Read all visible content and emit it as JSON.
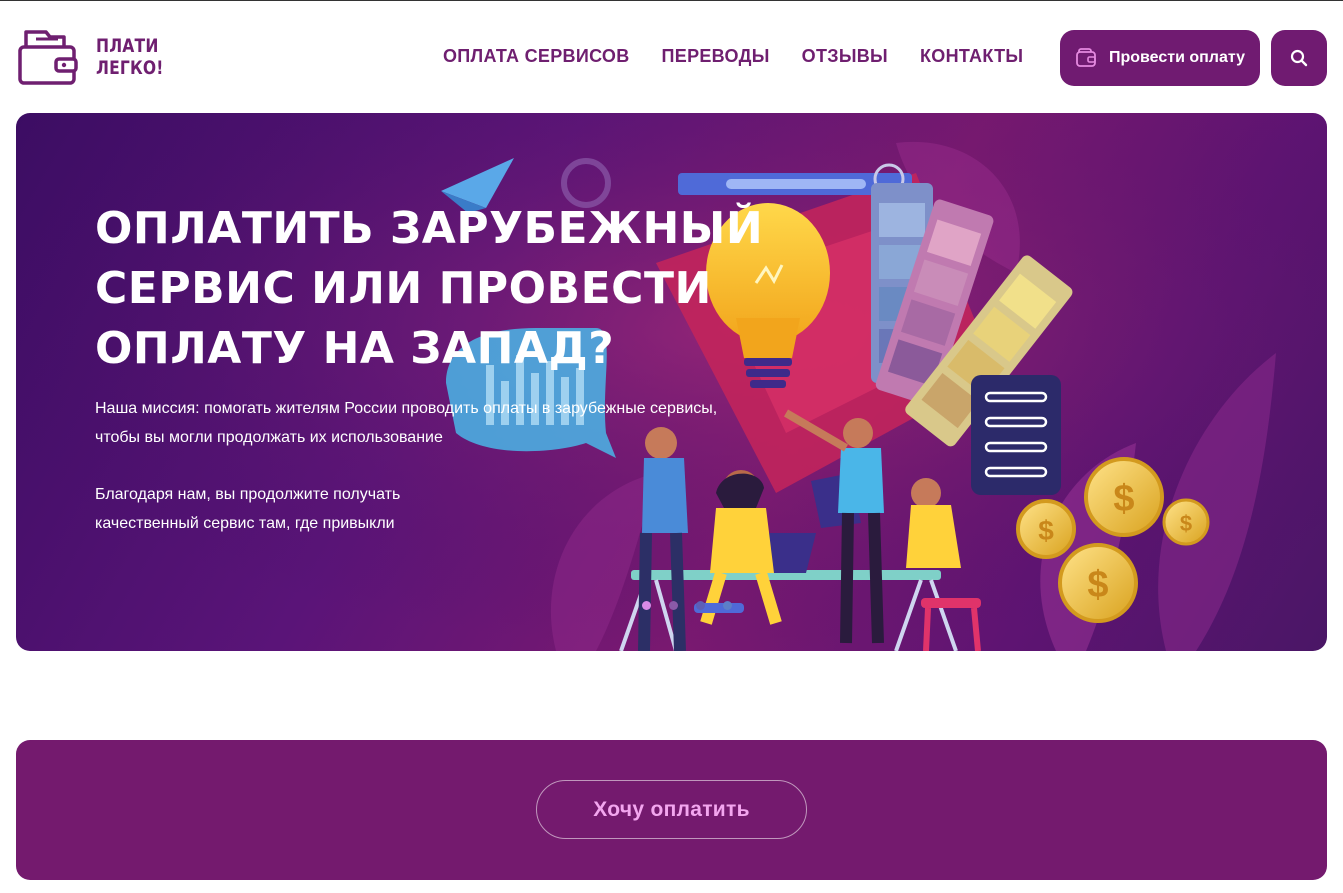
{
  "brand": {
    "logo_line1": "ПЛАТИ",
    "logo_line2": "ЛЕГКО!",
    "logo_icon": "wallet-icon",
    "color": "#6f1f70"
  },
  "nav": {
    "items": [
      {
        "label": "ОПЛАТА СЕРВИСОВ"
      },
      {
        "label": "ПЕРЕВОДЫ"
      },
      {
        "label": "ОТЗЫВЫ"
      },
      {
        "label": "КОНТАКТЫ"
      }
    ]
  },
  "header_actions": {
    "pay_label": "Провести оплату",
    "pay_icon": "wallet-icon",
    "search_icon": "search-icon",
    "button_color": "#701b71"
  },
  "hero": {
    "title_lines": [
      "ОПЛАТИТЬ ЗАРУБЕЖНЫЙ",
      "СЕРВИС ИЛИ ПРОВЕСТИ",
      "ОПЛАТУ НА ЗАПАД?"
    ],
    "mission_lines": [
      "Наша миссия: помогать жителям России проводить оплаты в зарубежные сервисы,",
      "чтобы вы могли продолжать их использование"
    ],
    "benefit_lines": [
      "Благодаря нам, вы продолжите получать",
      "качественный сервис там, где привыкли"
    ],
    "slides_total": 4,
    "active_slide": 1,
    "dot_colors": [
      "#d98ae6",
      "#8a5aa8",
      "#5c5fb8",
      "#5c7fc8"
    ]
  },
  "cta": {
    "button_label": "Хочу оплатить",
    "background": "#741a6e",
    "label_color": "#f3a6ef"
  }
}
